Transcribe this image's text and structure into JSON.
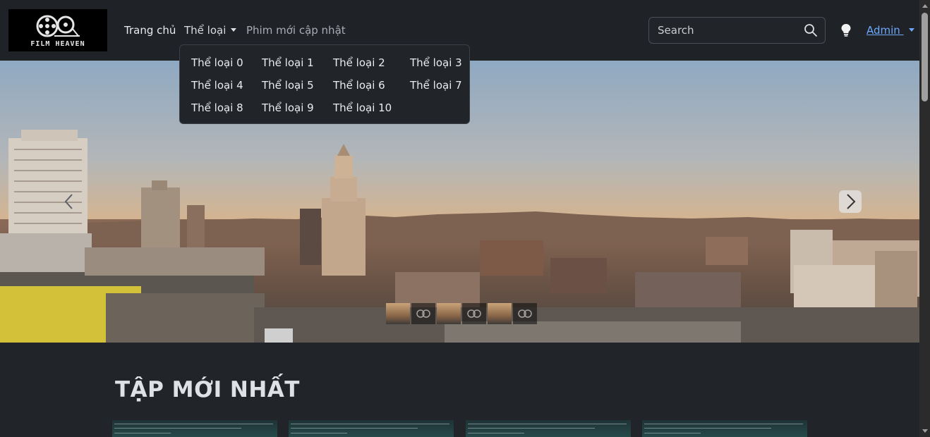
{
  "brand": {
    "logo_text": "FILM HEAVEN"
  },
  "nav": {
    "home": "Trang chủ",
    "genre": "Thể loại",
    "new_movies": "Phim mới cập nhật"
  },
  "search": {
    "placeholder": "Search"
  },
  "user": {
    "name": "Admin "
  },
  "genre_dropdown": {
    "items": [
      "Thể loại 0",
      "Thể loại 1",
      "Thể loại 2",
      "Thể loại 3",
      "Thể loại 4",
      "Thể loại 5",
      "Thể loại 6",
      "Thể loại 7",
      "Thể loại 8",
      "Thể loại 9",
      "Thể loại 10"
    ]
  },
  "carousel": {
    "indicator_count": 6,
    "active_index": 4
  },
  "latest": {
    "title": "TẬP MỚI NHẤT",
    "card_count": 4
  },
  "colors": {
    "background": "#212529",
    "link": "#6ea8fe",
    "navbar": "#1f2226"
  },
  "icons": [
    "search-icon",
    "lightbulb-icon",
    "chevron-left-icon",
    "chevron-right-icon",
    "caret-down-icon"
  ]
}
